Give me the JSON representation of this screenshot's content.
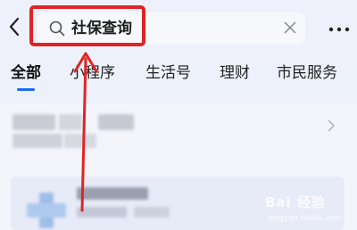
{
  "header": {
    "back_icon": "chevron-left-icon",
    "search": {
      "icon": "search-icon",
      "value": "社保查询",
      "clear_icon": "close-icon"
    },
    "more_icon": "more-dots-icon"
  },
  "tabs": [
    {
      "label": "全部",
      "active": true
    },
    {
      "label": "小程序",
      "active": false
    },
    {
      "label": "生活号",
      "active": false
    },
    {
      "label": "理财",
      "active": false
    },
    {
      "label": "市民服务",
      "active": false
    }
  ],
  "annotation": {
    "highlight_color": "#e02424",
    "arrow_color": "#e02424"
  },
  "accent_color": "#1a6cf2",
  "watermark": {
    "logo_text": "Bai 经验",
    "url_text": "jingyan.baidu.com"
  }
}
